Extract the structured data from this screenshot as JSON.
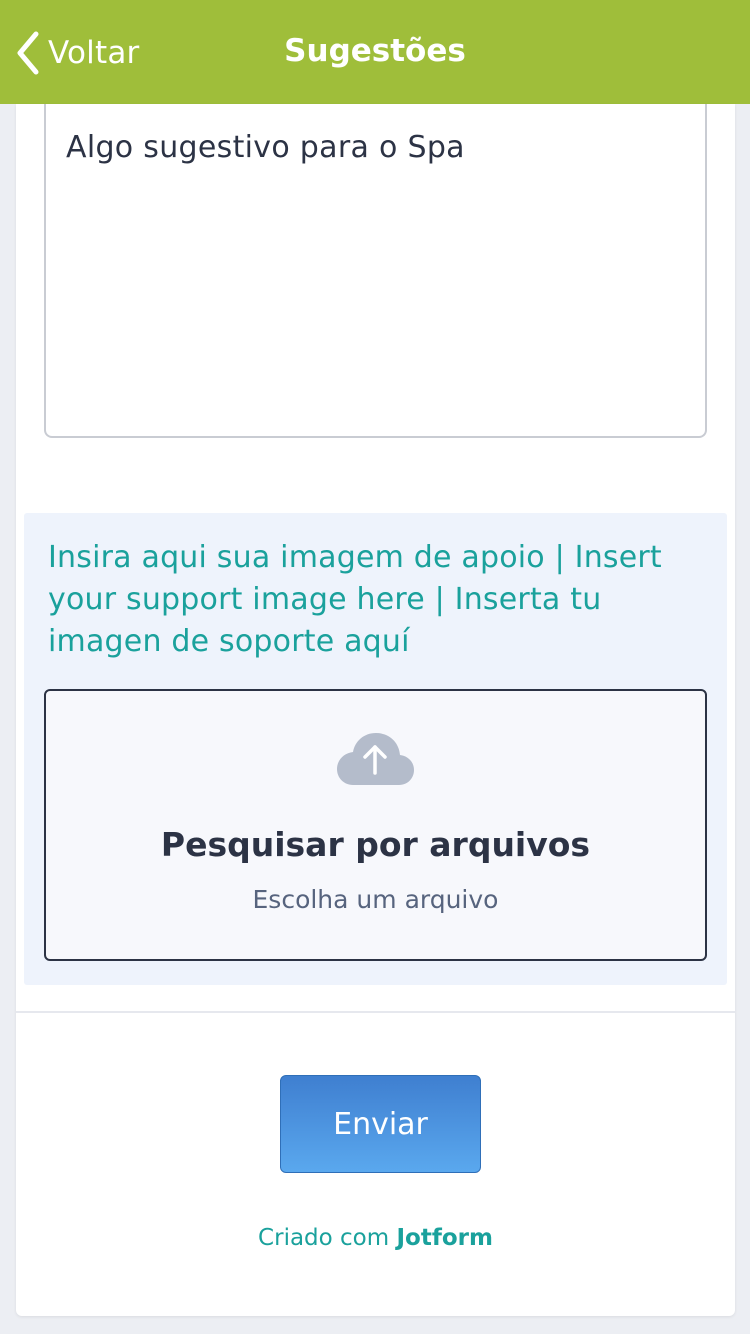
{
  "nav": {
    "back_label": "Voltar",
    "title": "Sugestões",
    "background_color": "#9fbe3a",
    "back_icon": "chevron-left-icon"
  },
  "form": {
    "textarea_value": "Algo sugestivo para o Spa",
    "upload": {
      "label": "Insira aqui sua imagem de apoio | Insert your support image here | Inserta tu imagen de soporte aquí",
      "icon": "cloud-upload-icon",
      "title": "Pesquisar por arquivos",
      "subtitle": "Escolha um arquivo"
    },
    "submit_label": "Enviar"
  },
  "footer": {
    "prefix": "Criado com",
    "brand": "Jotform"
  },
  "colors": {
    "accent_teal": "#1aa19c",
    "button_blue": "#4a90e2",
    "text_dark": "#2c3345"
  }
}
